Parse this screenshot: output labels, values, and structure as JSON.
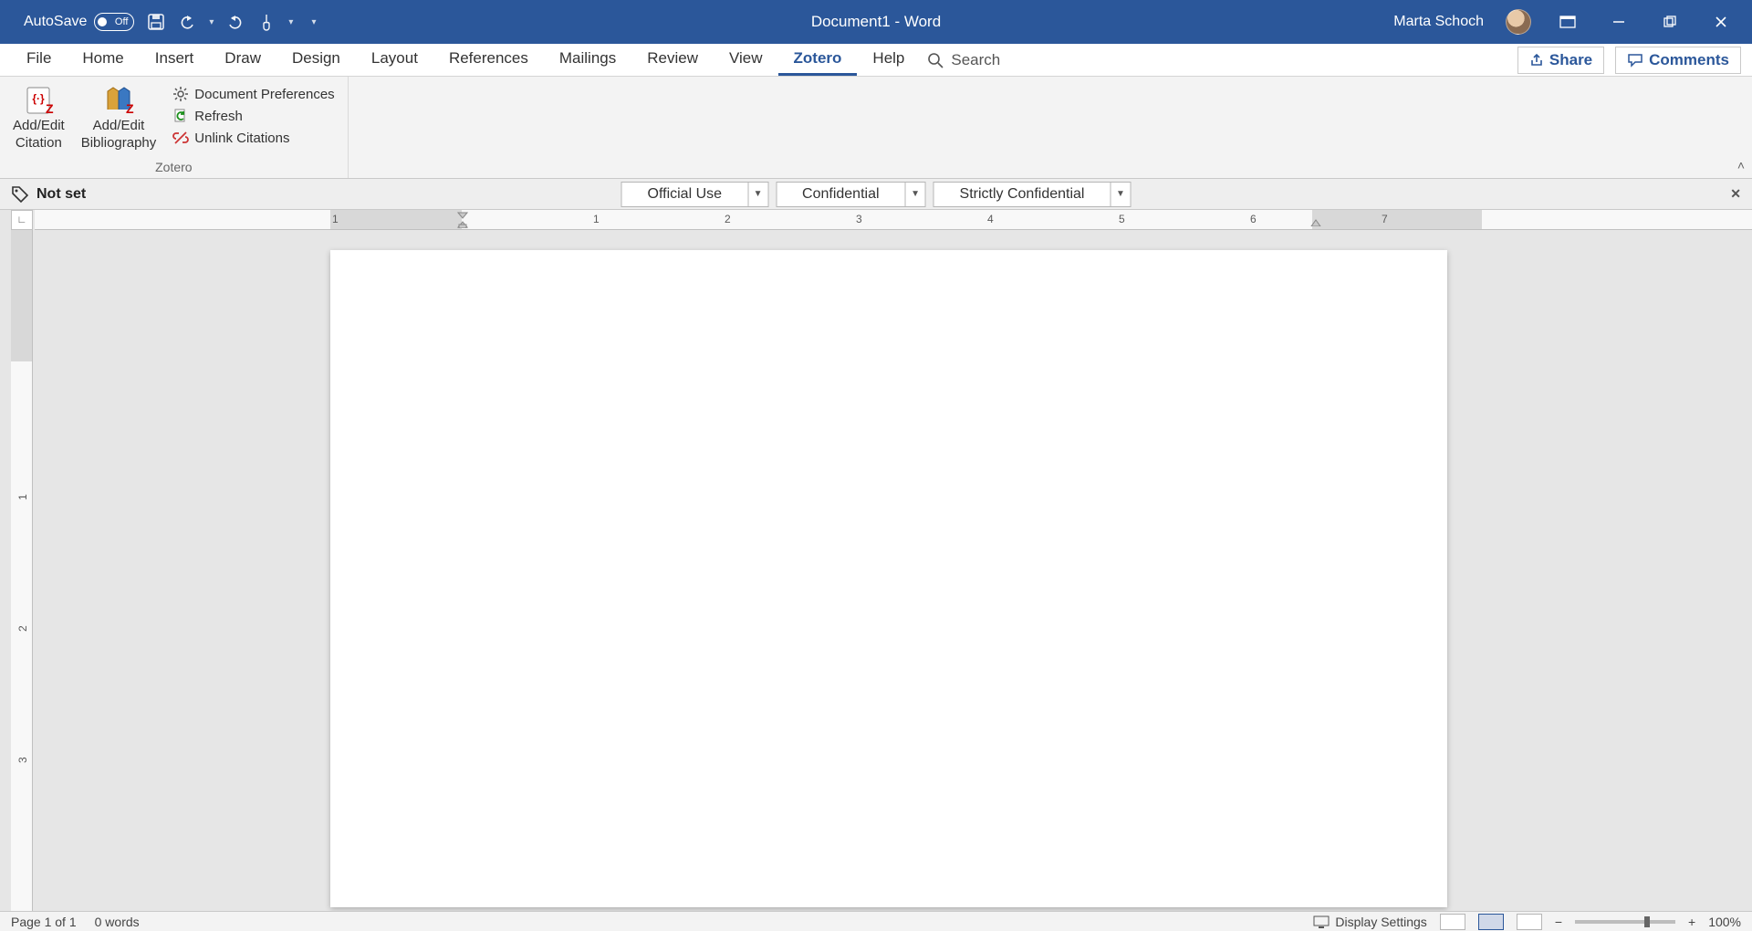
{
  "titlebar": {
    "autosave_label": "AutoSave",
    "autosave_state": "Off",
    "doc_title": "Document1  -  Word",
    "user_name": "Marta Schoch"
  },
  "tabs": {
    "items": [
      "File",
      "Home",
      "Insert",
      "Draw",
      "Design",
      "Layout",
      "References",
      "Mailings",
      "Review",
      "View",
      "Zotero",
      "Help"
    ],
    "active_index": 10,
    "search_label": "Search",
    "share_label": "Share",
    "comments_label": "Comments"
  },
  "ribbon": {
    "group_label": "Zotero",
    "btn_citation_l1": "Add/Edit",
    "btn_citation_l2": "Citation",
    "btn_biblio_l1": "Add/Edit",
    "btn_biblio_l2": "Bibliography",
    "btn_prefs": "Document Preferences",
    "btn_refresh": "Refresh",
    "btn_unlink": "Unlink Citations"
  },
  "classification": {
    "status": "Not set",
    "options": [
      "Official Use",
      "Confidential",
      "Strictly Confidential"
    ]
  },
  "ruler": {
    "h_numbers": [
      "1",
      "1",
      "2",
      "3",
      "4",
      "5",
      "6",
      "7"
    ],
    "v_numbers": [
      "1",
      "2",
      "3"
    ]
  },
  "statusbar": {
    "page": "Page 1 of 1",
    "words": "0 words",
    "display_settings": "Display Settings",
    "zoom": "100%"
  }
}
